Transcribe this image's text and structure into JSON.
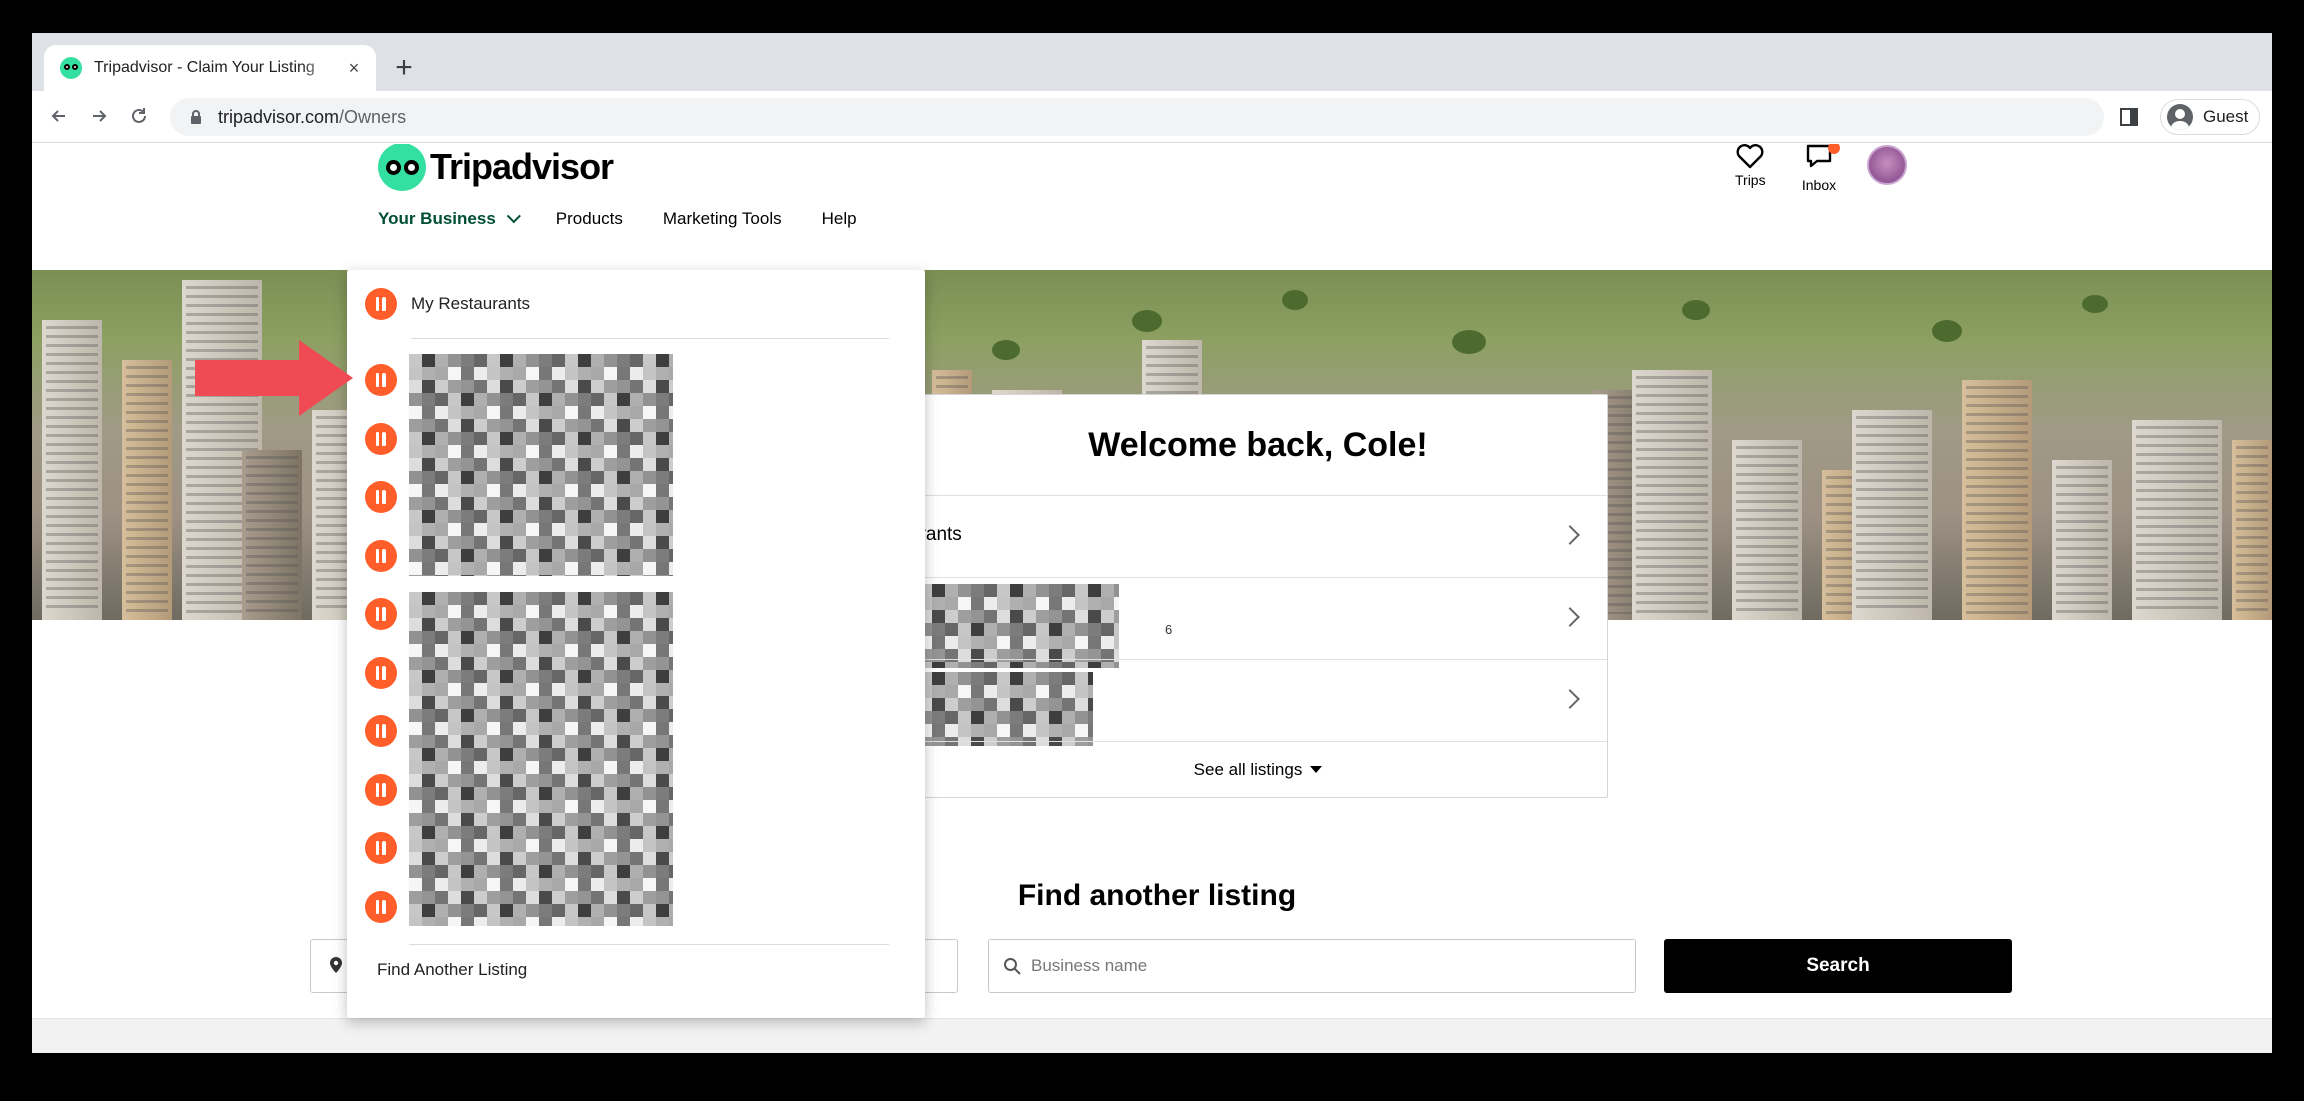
{
  "browser": {
    "tab_title": "Tripadvisor - Claim Your Listing",
    "tab_close": "×",
    "new_tab": "+",
    "url_domain": "tripadvisor.com",
    "url_path": "/Owners",
    "profile_label": "Guest"
  },
  "header": {
    "logo_text": "Tripadvisor",
    "trips_label": "Trips",
    "inbox_label": "Inbox"
  },
  "nav": {
    "items": [
      {
        "label": "Your Business"
      },
      {
        "label": "Products"
      },
      {
        "label": "Marketing Tools"
      },
      {
        "label": "Help"
      }
    ]
  },
  "dropdown": {
    "first_item": "My Restaurants",
    "restaurant_count": 10,
    "footer_link": "Find Another Listing"
  },
  "welcome": {
    "title": "Welcome back, Cole!",
    "row1_text": "urants",
    "row2_text": "S",
    "row2_sub_left": "<",
    "row2_sub_right": "6",
    "row3_sub_left": "u",
    "see_all": "See all listings"
  },
  "find": {
    "title": "Find another listing",
    "business_placeholder": "Business name",
    "search_label": "Search"
  },
  "colors": {
    "brand_green": "#34e0a1",
    "nav_active": "#004f32",
    "restaurant_orange": "#ff5d2a",
    "annotation_arrow": "#f04a55"
  }
}
